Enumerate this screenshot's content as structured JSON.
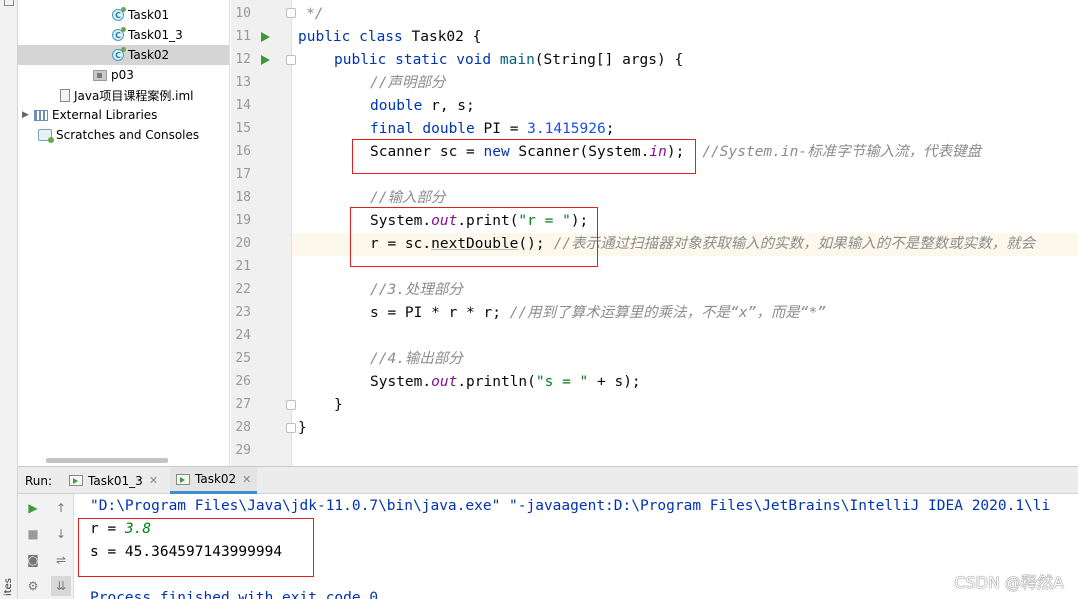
{
  "left_strip": {
    "label": "ites"
  },
  "project_tree": {
    "items": [
      {
        "label": "Task01",
        "type": "class"
      },
      {
        "label": "Task01_3",
        "type": "class"
      },
      {
        "label": "Task02",
        "type": "class",
        "selected": true
      },
      {
        "label": "p03",
        "type": "package"
      },
      {
        "label": "Java项目课程案例.iml",
        "type": "iml"
      },
      {
        "label": "External Libraries",
        "type": "library"
      },
      {
        "label": "Scratches and Consoles",
        "type": "scratch"
      }
    ]
  },
  "editor": {
    "line_numbers": [
      "10",
      "11",
      "12",
      "13",
      "14",
      "15",
      "16",
      "17",
      "18",
      "19",
      "20",
      "21",
      "22",
      "23",
      "24",
      "25",
      "26",
      "27",
      "28",
      "29"
    ],
    "code": {
      "l10": "*/",
      "l11_kw": "public class ",
      "l11_name": "Task02 {",
      "l12_kw1": "public static void ",
      "l12_fn": "main",
      "l12_rest": "(String[] args) {",
      "l13_cmt": "//声明部分",
      "l14_kw": "double ",
      "l14_rest": "r, s;",
      "l15_kw": "final double ",
      "l15_mid": "PI = ",
      "l15_num": "3.1415926",
      "l15_end": ";",
      "l16_a": "Scanner sc = ",
      "l16_kw": "new ",
      "l16_b": "Scanner(System.",
      "l16_fld": "in",
      "l16_c": ");",
      "l16_cmt": "//System.in-标准字节输入流，代表键盘",
      "l18_cmt": "//输入部分",
      "l19_a": "System.",
      "l19_fld": "out",
      "l19_b": ".print(",
      "l19_str": "\"r = \"",
      "l19_c": ");",
      "l20_a": "r = sc.",
      "l20_fn": "nextDouble",
      "l20_b": "();",
      "l20_cmt": "//表示通过扫描器对象获取输入的实数，如果输入的不是整数或实数，就会",
      "l22_cmt": "//3.处理部分",
      "l23_code": "s = PI * r * r; ",
      "l23_cmt": "//用到了算术运算里的乘法，不是“x”，而是“*”",
      "l25_cmt": "//4.输出部分",
      "l26_a": "System.",
      "l26_fld": "out",
      "l26_b": ".println(",
      "l26_str": "\"s = \"",
      "l26_c": " + s);",
      "l27": "}",
      "l28": "}"
    }
  },
  "run_panel": {
    "label": "Run:",
    "tabs": [
      {
        "label": "Task01_3",
        "active": false
      },
      {
        "label": "Task02",
        "active": true
      }
    ],
    "console": {
      "command": "\"D:\\Program Files\\Java\\jdk-11.0.7\\bin\\java.exe\" \"-javaagent:D:\\Program Files\\JetBrains\\IntelliJ IDEA 2020.1\\li",
      "prompt": "r = ",
      "input": "3.8",
      "result": "s = 45.364597143999994",
      "finished": "Process finished with exit code 0"
    }
  },
  "watermark": "CSDN @释然A",
  "colors": {
    "keyword": "#0033b3",
    "string": "#067d17",
    "number": "#1750eb",
    "comment": "#8c8c8c",
    "field": "#871094",
    "highlight_box": "#e02020",
    "tab_accent": "#3d8fd1"
  }
}
